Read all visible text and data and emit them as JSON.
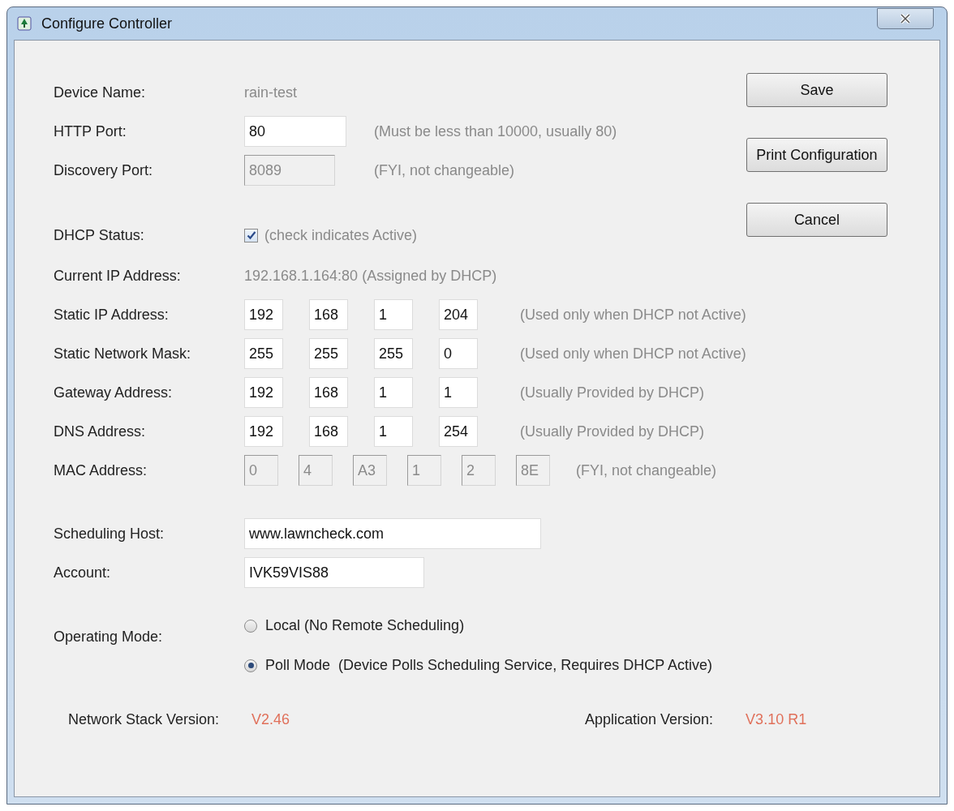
{
  "window": {
    "title": "Configure Controller"
  },
  "rows": [
    {
      "kind": "text",
      "label": "Device Name:",
      "value": "rain-test"
    },
    {
      "kind": "input",
      "label": "HTTP Port:",
      "values": [
        "80"
      ],
      "disabled": false,
      "hint": "(Must be less than 10000, usually 80)"
    },
    {
      "kind": "input",
      "label": "Discovery Port:",
      "values": [
        "8089"
      ],
      "disabled": true,
      "hint": "(FYI, not changeable)"
    },
    {
      "kind": "gap"
    },
    {
      "kind": "checkbox",
      "label": "DHCP Status:",
      "checked": true,
      "hint": "(check indicates Active)"
    },
    {
      "kind": "text",
      "label": "Current IP Address:",
      "value": "192.168.1.164:80  (Assigned by DHCP)"
    },
    {
      "kind": "octets",
      "label": "Static IP Address:",
      "values": [
        "192",
        "168",
        "1",
        "204"
      ],
      "disabled": false,
      "hint": "(Used only when DHCP not Active)"
    },
    {
      "kind": "octets",
      "label": "Static Network Mask:",
      "values": [
        "255",
        "255",
        "255",
        "0"
      ],
      "disabled": false,
      "hint": "(Used only when DHCP not Active)"
    },
    {
      "kind": "octets",
      "label": "Gateway Address:",
      "values": [
        "192",
        "168",
        "1",
        "1"
      ],
      "disabled": false,
      "hint": "(Usually Provided by DHCP)"
    },
    {
      "kind": "octets",
      "label": "DNS Address:",
      "values": [
        "192",
        "168",
        "1",
        "254"
      ],
      "disabled": false,
      "hint": "(Usually Provided by DHCP)"
    },
    {
      "kind": "mac",
      "label": "MAC Address:",
      "values": [
        "0",
        "4",
        "A3",
        "1",
        "2",
        "8E"
      ],
      "disabled": true,
      "hint": "(FYI, not changeable)"
    },
    {
      "kind": "gap"
    },
    {
      "kind": "wide",
      "label": "Scheduling Host:",
      "values": [
        "www.lawncheck.com"
      ],
      "disabled": false
    },
    {
      "kind": "medium",
      "label": "Account:",
      "values": [
        "IVK59VIS88"
      ],
      "disabled": false
    }
  ],
  "operating_mode": {
    "label": "Operating Mode:",
    "options": [
      {
        "label": "Local (No Remote Scheduling)",
        "selected": false
      },
      {
        "label": "Poll Mode  (Device Polls Scheduling Service, Requires DHCP Active)",
        "selected": true
      }
    ]
  },
  "buttons": [
    "Save",
    "Print Configuration",
    "Cancel"
  ],
  "versions": [
    {
      "label": "Network Stack Version:",
      "value": "V2.46"
    },
    {
      "label": "Application Version:",
      "value": "V3.10 R1"
    }
  ]
}
